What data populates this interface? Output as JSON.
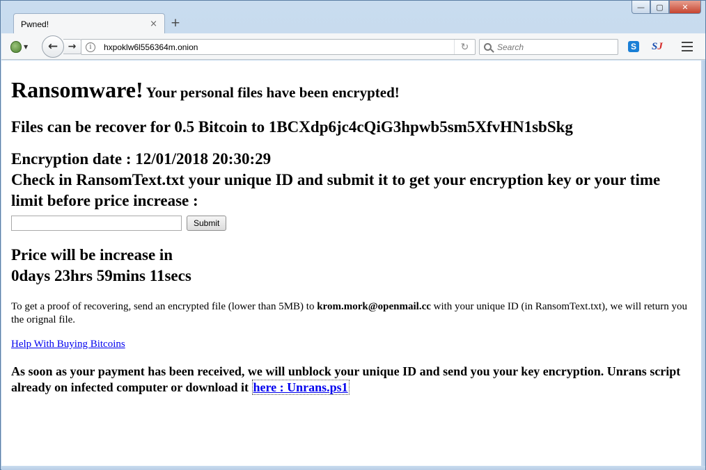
{
  "window": {
    "minimize_label": "—",
    "maximize_label": "▢",
    "close_label": "✕"
  },
  "tab": {
    "title": "Pwned!",
    "close_glyph": "×",
    "new_tab_glyph": "+"
  },
  "navbar": {
    "back_glyph": "←",
    "forward_glyph": "→",
    "info_glyph": "i",
    "url": "hxpoklw6l556364m.onion",
    "reload_glyph": "↻",
    "search_placeholder": "Search",
    "ext_skype_label": "S",
    "ext_sj_label_s": "S",
    "ext_sj_label_j": "J",
    "tor_caret": "▼"
  },
  "page": {
    "title_big": "Ransomware!",
    "title_sub": "Your personal files have been encrypted!",
    "recover_text": "Files can be recover for 0.5 Bitcoin to 1BCXdp6jc4cQiG3hpwb5sm5XfvHN1sbSkg",
    "encryption_date": "Encryption date : 12/01/2018 20:30:29",
    "check_text": "Check in RansomText.txt your unique ID and submit it to get your encryption key or your time limit before price increase :",
    "id_input_value": "",
    "submit_label": "Submit",
    "price_heading": "Price will be increase in",
    "countdown": "0days 23hrs 59mins 11secs",
    "proof_before": "To get a proof of recovering, send an encrypted file (lower than 5MB) to ",
    "proof_email": "krom.mork@openmail.cc",
    "proof_after": " with your unique ID (in RansomText.txt), we will return you the orignal file.",
    "help_link": "Help With Buying Bitcoins",
    "final_text": "As soon as your payment has been received, we will unblock your unique ID and send you your key encryption. Unrans script already on infected computer or download it ",
    "final_link": "here : Unrans.ps1"
  }
}
